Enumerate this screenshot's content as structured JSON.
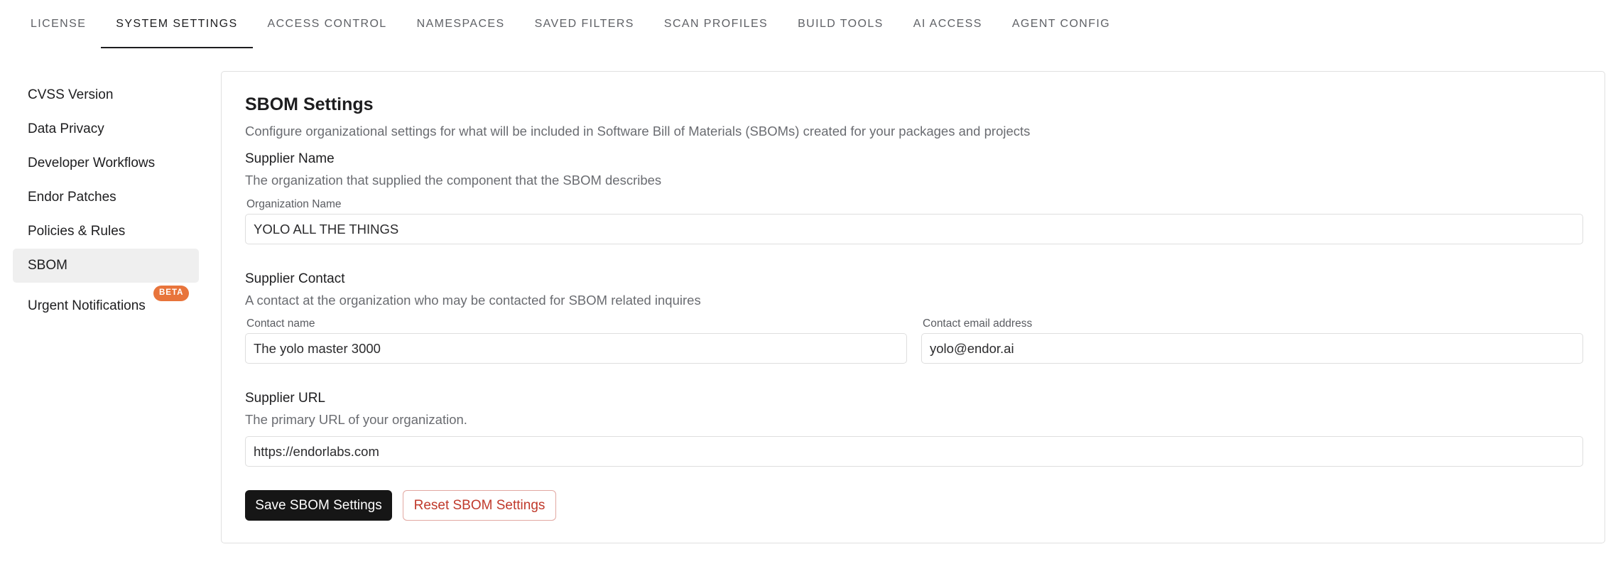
{
  "tabs": [
    {
      "label": "LICENSE",
      "active": false
    },
    {
      "label": "SYSTEM SETTINGS",
      "active": true
    },
    {
      "label": "ACCESS CONTROL",
      "active": false
    },
    {
      "label": "NAMESPACES",
      "active": false
    },
    {
      "label": "SAVED FILTERS",
      "active": false
    },
    {
      "label": "SCAN PROFILES",
      "active": false
    },
    {
      "label": "BUILD TOOLS",
      "active": false
    },
    {
      "label": "AI ACCESS",
      "active": false
    },
    {
      "label": "AGENT CONFIG",
      "active": false
    }
  ],
  "sidebar": {
    "items": [
      {
        "label": "CVSS Version"
      },
      {
        "label": "Data Privacy"
      },
      {
        "label": "Developer Workflows"
      },
      {
        "label": "Endor Patches"
      },
      {
        "label": "Policies & Rules"
      },
      {
        "label": "SBOM",
        "active": true
      },
      {
        "label": "Urgent Notifications",
        "badge": "BETA"
      }
    ]
  },
  "card": {
    "title": "SBOM Settings",
    "description": "Configure organizational settings for what will be included in Software Bill of Materials (SBOMs) created for your packages and projects",
    "supplier_name": {
      "title": "Supplier Name",
      "description": "The organization that supplied the component that the SBOM describes",
      "org_label": "Organization Name",
      "org_value": "YOLO ALL THE THINGS"
    },
    "supplier_contact": {
      "title": "Supplier Contact",
      "description": "A contact at the organization who may be contacted for SBOM related inquires",
      "name_label": "Contact name",
      "name_value": "The yolo master 3000",
      "email_label": "Contact email address",
      "email_value": "yolo@endor.ai"
    },
    "supplier_url": {
      "title": "Supplier URL",
      "description": "The primary URL of your organization.",
      "url_value": "https://endorlabs.com"
    },
    "save_label": "Save SBOM Settings",
    "reset_label": "Reset SBOM Settings"
  },
  "colors": {
    "accent_dark": "#161616",
    "danger": "#c0392b",
    "beta_badge": "#e8743b"
  }
}
